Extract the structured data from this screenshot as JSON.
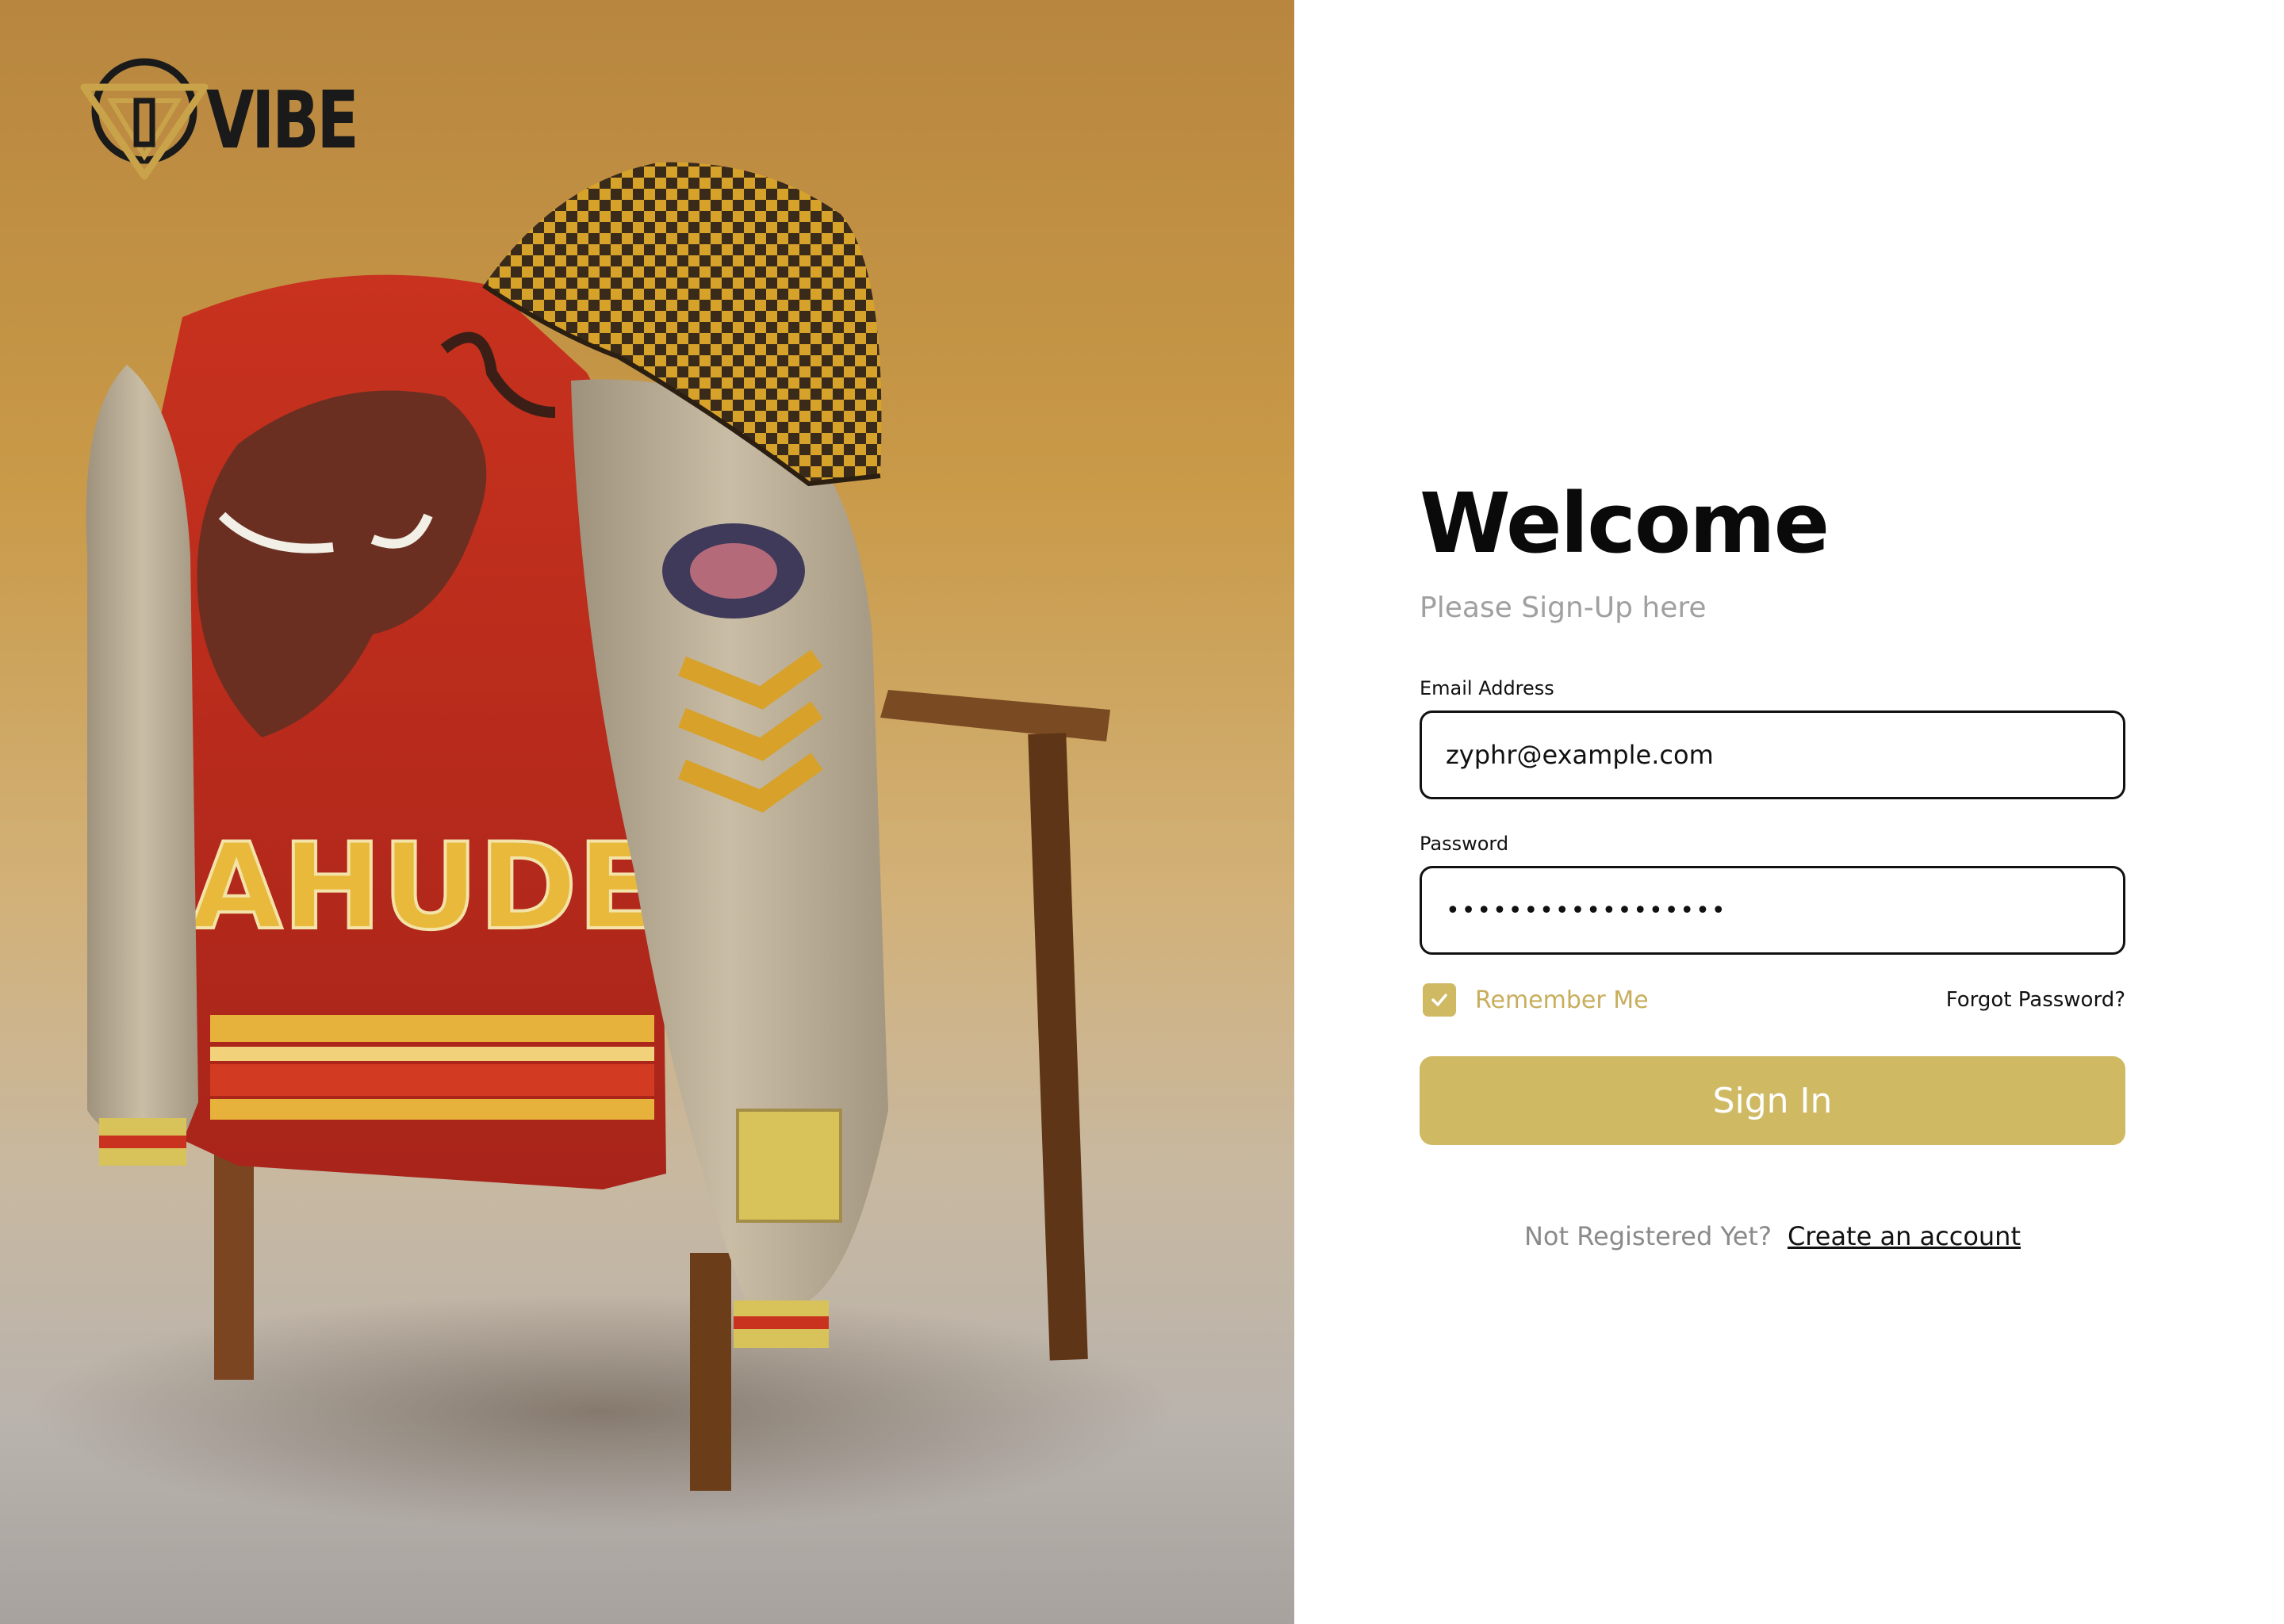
{
  "brand": {
    "name": "VIBE",
    "logo_icon": "triangle-circle-logo-icon"
  },
  "hero": {
    "image_description_icon": "varsity-jacket-on-chair-photo"
  },
  "form": {
    "title": "Welcome",
    "subtitle": "Please Sign-Up here",
    "email": {
      "label": "Email Address",
      "value": "zyphr@example.com"
    },
    "password": {
      "label": "Password",
      "masked_value": "••••••••••••••••••"
    },
    "remember_me": {
      "label": "Remember Me",
      "checked": true,
      "icon": "check-icon"
    },
    "forgot_password": "Forgot Password?",
    "sign_in_button": "Sign In",
    "register": {
      "question": "Not Registered Yet?",
      "link": "Create an account"
    }
  },
  "colors": {
    "accent_gold": "#cfb963",
    "text_dark": "#111111",
    "muted_gray": "#a0a0a0"
  }
}
